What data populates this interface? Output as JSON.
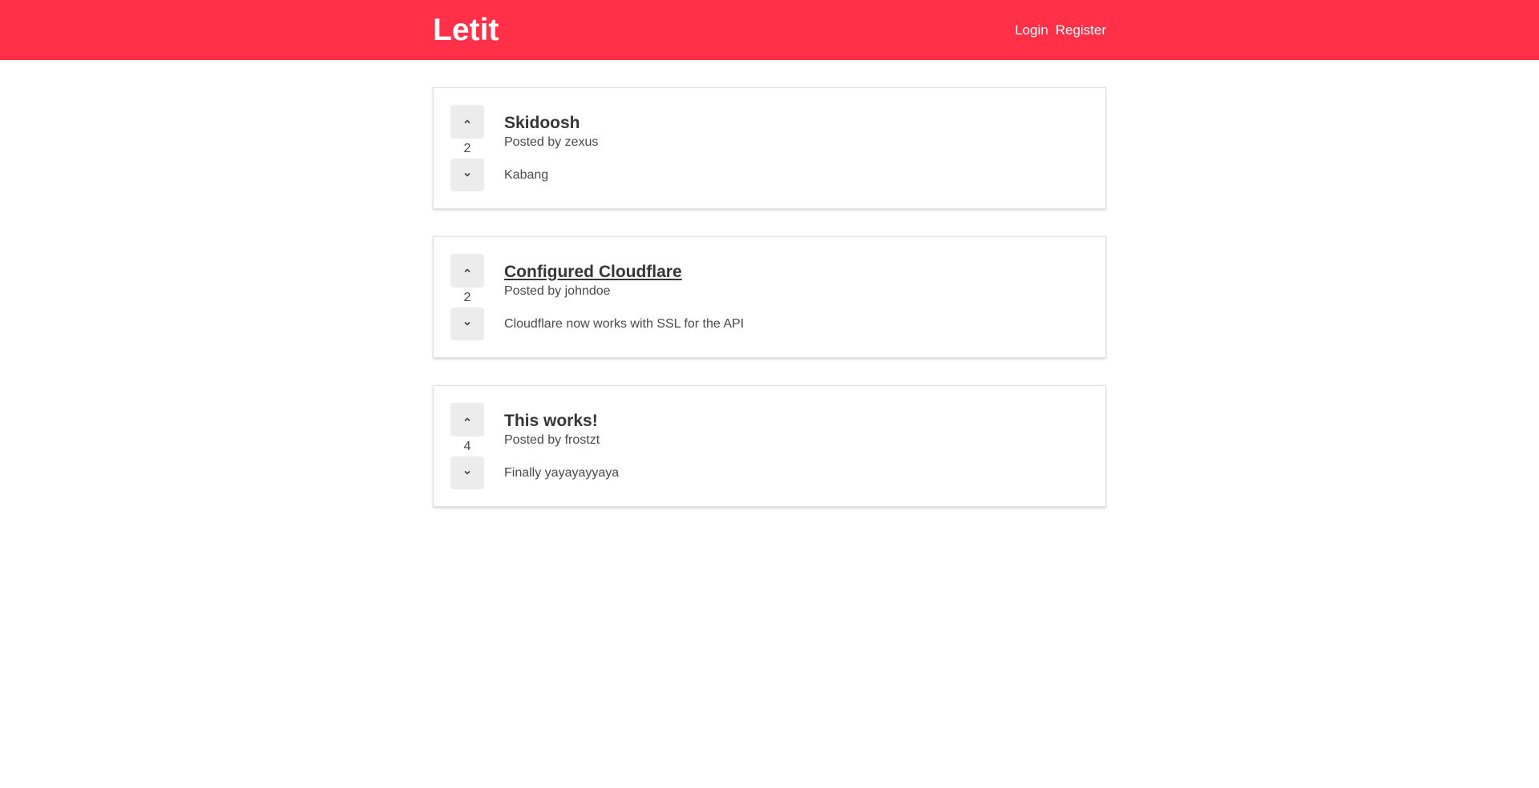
{
  "header": {
    "brand": "Letit",
    "login_label": "Login",
    "register_label": "Register"
  },
  "colors": {
    "brand_red": "#ff3047"
  },
  "posts": [
    {
      "title": "Skidoosh",
      "posted_by_label": "Posted by",
      "author": "zexus",
      "score": "2",
      "body": "Kabang"
    },
    {
      "title": "Configured Cloudflare",
      "posted_by_label": "Posted by",
      "author": "johndoe",
      "score": "2",
      "body": "Cloudflare now works with SSL for the API"
    },
    {
      "title": "This works!",
      "posted_by_label": "Posted by",
      "author": "frostzt",
      "score": "4",
      "body": "Finally yayayayyaya"
    }
  ],
  "icons": {
    "upvote": "chevron-up-icon",
    "downvote": "chevron-down-icon"
  }
}
